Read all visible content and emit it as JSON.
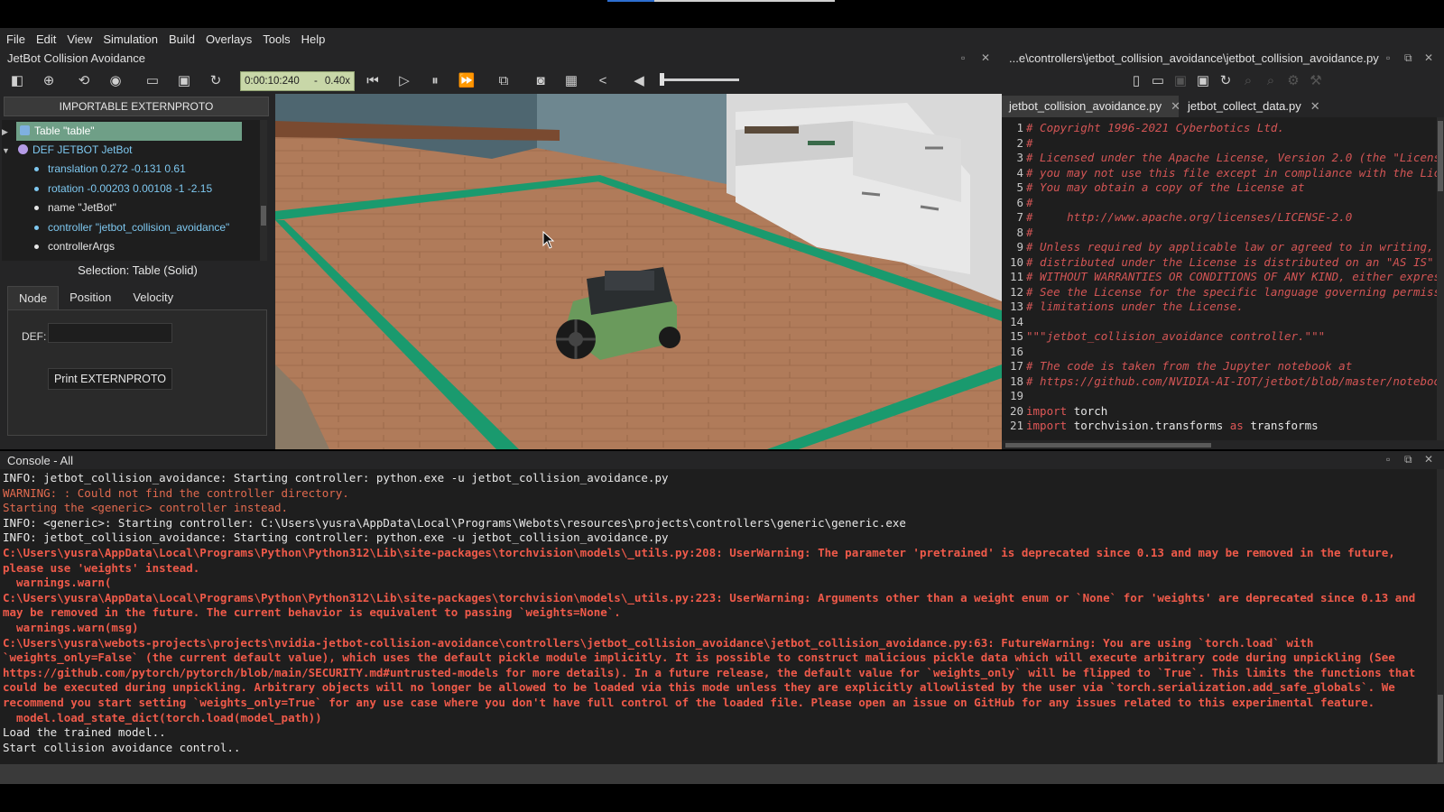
{
  "menu": [
    "File",
    "Edit",
    "View",
    "Simulation",
    "Build",
    "Overlays",
    "Tools",
    "Help"
  ],
  "sim_window": {
    "title": "JetBot Collision Avoidance"
  },
  "toolbar": {
    "time": "0:00:10:240",
    "separator": "-",
    "speed": "0.40x"
  },
  "scene_tree": {
    "extern_button": "IMPORTABLE EXTERNPROTO",
    "items": [
      "Table \"table\"",
      "DEF JETBOT JetBot",
      "translation 0.272 -0.131 0.61",
      "rotation -0.00203 0.00108 -1 -2.15",
      "name \"JetBot\"",
      "controller \"jetbot_collision_avoidance\"",
      "controllerArgs"
    ]
  },
  "selection": "Selection: Table (Solid)",
  "node_tabs": [
    "Node",
    "Position",
    "Velocity"
  ],
  "node_panel": {
    "def_label": "DEF:",
    "def_value": "",
    "print_button": "Print EXTERNPROTO"
  },
  "editor": {
    "title": "...e\\controllers\\jetbot_collision_avoidance\\jetbot_collision_avoidance.py",
    "tabs": [
      "jetbot_collision_avoidance.py",
      "jetbot_collect_data.py"
    ],
    "tab_close": "✕",
    "lines": [
      "# Copyright 1996-2021 Cyberbotics Ltd.",
      "#",
      "# Licensed under the Apache License, Version 2.0 (the \"Licens",
      "# you may not use this file except in compliance with the Lic",
      "# You may obtain a copy of the License at",
      "#",
      "#     http://www.apache.org/licenses/LICENSE-2.0",
      "#",
      "# Unless required by applicable law or agreed to in writing, ",
      "# distributed under the License is distributed on an \"AS IS\" ",
      "# WITHOUT WARRANTIES OR CONDITIONS OF ANY KIND, either expres",
      "# See the License for the specific language governing permiss",
      "# limitations under the License.",
      "",
      "\"\"\"jetbot_collision_avoidance controller.\"\"\"",
      "",
      "# The code is taken from the Jupyter notebook at",
      "# https://github.com/NVIDIA-AI-IOT/jetbot/blob/master/noteboo",
      "",
      "import torch",
      "import torchvision.transforms as transforms"
    ]
  },
  "console": {
    "title": "Console - All",
    "lines": [
      "INFO: jetbot_collision_avoidance: Starting controller: python.exe -u jetbot_collision_avoidance.py",
      "WARNING: : Could not find the controller directory.",
      "Starting the <generic> controller instead.",
      "INFO: <generic>: Starting controller: C:\\Users\\yusra\\AppData\\Local\\Programs\\Webots\\resources\\projects\\controllers\\generic\\generic.exe",
      "INFO: jetbot_collision_avoidance: Starting controller: python.exe -u jetbot_collision_avoidance.py",
      "C:\\Users\\yusra\\AppData\\Local\\Programs\\Python\\Python312\\Lib\\site-packages\\torchvision\\models\\_utils.py:208: UserWarning: The parameter 'pretrained' is deprecated since 0.13 and may be removed in the future,",
      "please use 'weights' instead.",
      "  warnings.warn(",
      "C:\\Users\\yusra\\AppData\\Local\\Programs\\Python\\Python312\\Lib\\site-packages\\torchvision\\models\\_utils.py:223: UserWarning: Arguments other than a weight enum or `None` for 'weights' are deprecated since 0.13 and",
      "may be removed in the future. The current behavior is equivalent to passing `weights=None`.",
      "  warnings.warn(msg)",
      "C:\\Users\\yusra\\webots-projects\\projects\\nvidia-jetbot-collision-avoidance\\controllers\\jetbot_collision_avoidance\\jetbot_collision_avoidance.py:63: FutureWarning: You are using `torch.load` with",
      "`weights_only=False` (the current default value), which uses the default pickle module implicitly. It is possible to construct malicious pickle data which will execute arbitrary code during unpickling (See",
      "https://github.com/pytorch/pytorch/blob/main/SECURITY.md#untrusted-models for more details). In a future release, the default value for `weights_only` will be flipped to `True`. This limits the functions that",
      "could be executed during unpickling. Arbitrary objects will no longer be allowed to be loaded via this mode unless they are explicitly allowlisted by the user via `torch.serialization.add_safe_globals`. We",
      "recommend you start setting `weights_only=True` for any use case where you don't have full control of the loaded file. Please open an issue on GitHub for any issues related to this experimental feature.",
      "  model.load_state_dict(torch.load(model_path))",
      "Load the trained model..",
      "Start collision avoidance control.."
    ]
  },
  "colors": {
    "console_info": "#e8e8e8",
    "console_warning": "#e26a4f",
    "console_error": "#ef5a4a",
    "selected_node": "#6f9f87",
    "field_text": "#7ec8f0"
  }
}
